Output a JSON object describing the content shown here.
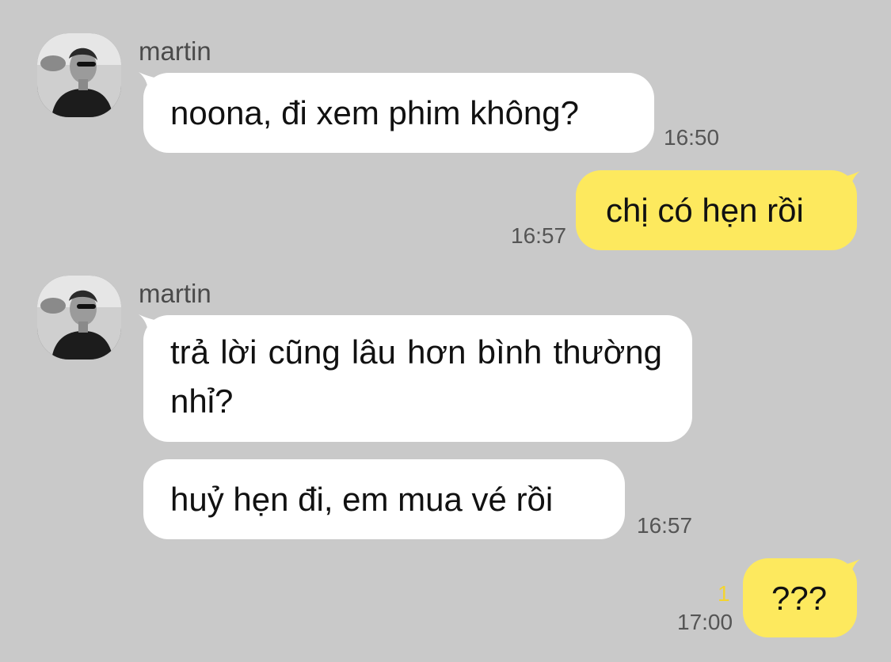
{
  "messages": [
    {
      "sender": "martin",
      "text": "noona, đi xem phim không?",
      "time": "16:50"
    },
    {
      "sender": "me",
      "text": "chị có hẹn rồi",
      "time": "16:57"
    },
    {
      "sender": "martin",
      "text": "trả lời cũng lâu hơn bình thường nhỉ?"
    },
    {
      "sender": "martin",
      "text": "huỷ hẹn đi, em mua vé rồi",
      "time": "16:57"
    },
    {
      "sender": "me",
      "text": "???",
      "time": "17:00",
      "unread": "1"
    }
  ],
  "colors": {
    "background": "#c9c9c9",
    "incoming_bubble": "#ffffff",
    "outgoing_bubble": "#fde95e",
    "unread_count": "#f3d430"
  },
  "icons": {
    "avatar": "profile-photo-icon"
  }
}
